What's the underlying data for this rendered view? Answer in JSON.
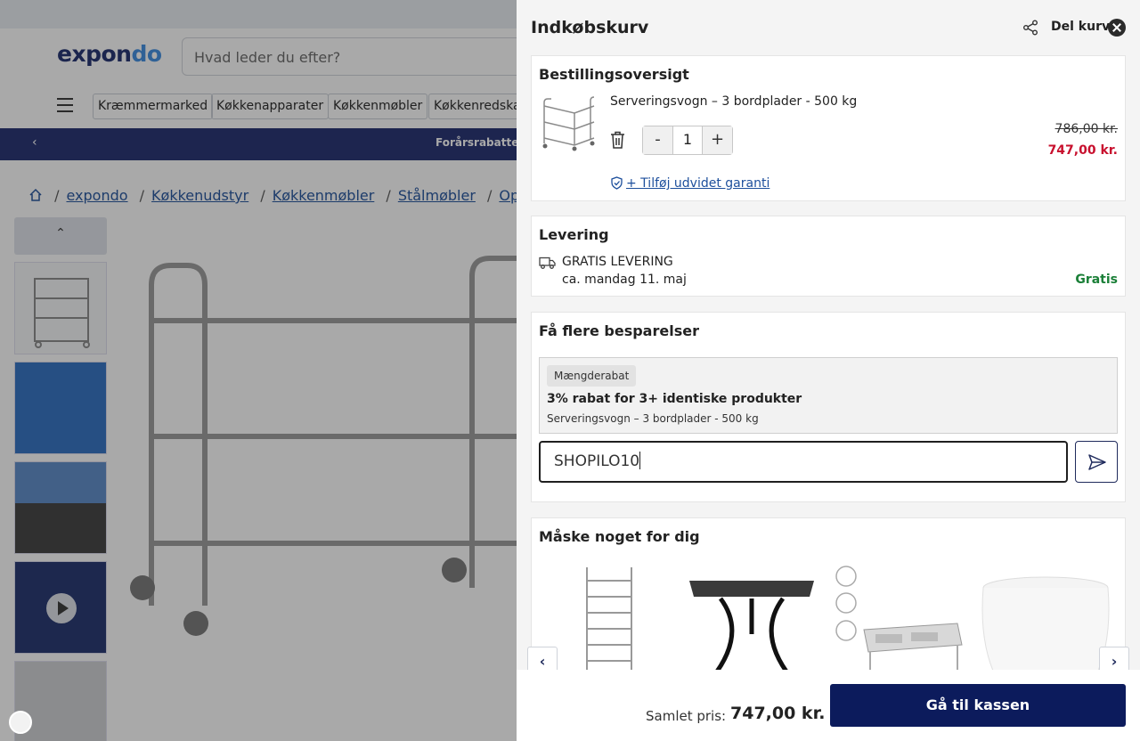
{
  "background": {
    "logo": {
      "part1": "expon",
      "part2": "do"
    },
    "search_placeholder": "Hvad leder du efter?",
    "categories": [
      "Kræmmermarked",
      "Køkkenapparater",
      "Køkkenmøbler",
      "Køkkenredskaber"
    ],
    "banner_text": "Forårsrabatter",
    "breadcrumbs": [
      "expondo",
      "Køkkenudstyr",
      "Køkkenmøbler",
      "Stålmøbler",
      "Opbevaring"
    ]
  },
  "cart": {
    "title": "Indkøbskurv",
    "share_label": "Del kurv",
    "order_summary": {
      "title": "Bestillingsoversigt",
      "item": {
        "name": "Serveringsvogn – 3 bordplader - 500 kg",
        "quantity": "1",
        "minus": "-",
        "plus": "+",
        "old_price": "786,00 kr.",
        "new_price": "747,00 kr.",
        "warranty_link": "+ Tilføj udvidet garanti"
      }
    },
    "delivery": {
      "title": "Levering",
      "method": "GRATIS LEVERING",
      "eta": "ca. mandag 11. maj",
      "price": "Gratis"
    },
    "savings": {
      "title": "Få flere besparelser",
      "badge": "Mængderabat",
      "promo_title": "3% rabat for 3+ identiske produkter",
      "promo_product": "Serveringsvogn – 3 bordplader - 500 kg",
      "code_value": "SHOPILO10"
    },
    "recommendations": {
      "title": "Måske noget for dig"
    },
    "footer": {
      "total_label": "Samlet pris:",
      "total_value": "747,00 kr.",
      "checkout_label": "Gå til kassen"
    }
  },
  "colors": {
    "accent_navy": "#0c1b5c",
    "sale_red": "#c8102e",
    "free_green": "#1a7f37",
    "link_blue": "#1d4f9c"
  }
}
